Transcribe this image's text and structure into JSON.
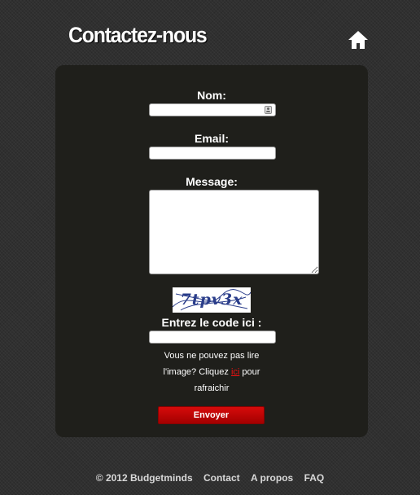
{
  "header": {
    "title": "Contactez-nous",
    "home_icon": "home-icon"
  },
  "form": {
    "name_label": "Nom:",
    "email_label": "Email:",
    "message_label": "Message:",
    "captcha_text": "7tpv3x",
    "code_label": "Entrez le code ici :",
    "help_prefix": "Vous ne pouvez pas lire l'image? Cliquez ",
    "help_link": "ici",
    "help_suffix": " pour rafraichir",
    "submit_label": "Envoyer",
    "name_value": "",
    "email_value": "",
    "message_value": "",
    "code_value": ""
  },
  "footer": {
    "copyright": "© 2012 Budgetminds",
    "links": [
      "Contact",
      "A propos",
      "FAQ"
    ]
  },
  "colors": {
    "panel": "#1f1f1b",
    "button": "#c40606",
    "link": "#e11111"
  }
}
